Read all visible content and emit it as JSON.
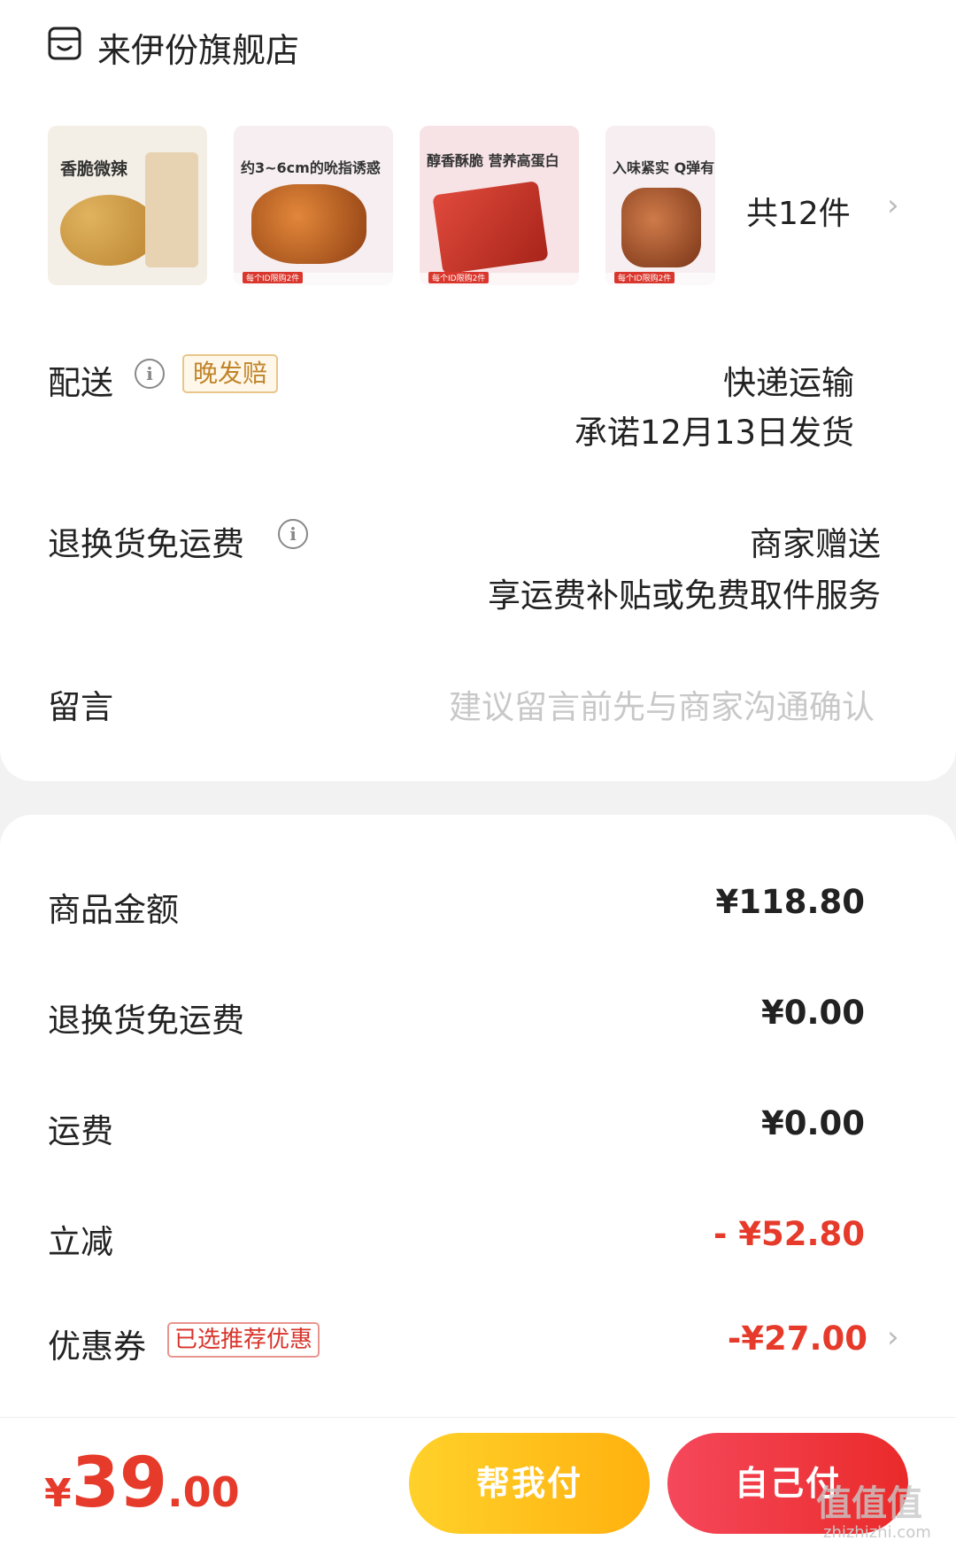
{
  "store": {
    "name": "来伊份旗舰店",
    "icon": "store-icon"
  },
  "products": [
    {
      "headline": "香脆微辣",
      "tag": ""
    },
    {
      "headline": "约3~6cm的吮指诱惑",
      "tag": "每个ID限购2件"
    },
    {
      "headline": "醇香酥脆 营养高蛋白",
      "tag": "每个ID限购2件"
    },
    {
      "headline": "入味紧实 Q弹有",
      "tag": "每个ID限购2件"
    }
  ],
  "product_count": "共12件",
  "delivery": {
    "label": "配送",
    "badge": "晚发赔",
    "method": "快递运输",
    "promise": "承诺12月13日发货"
  },
  "return_freight": {
    "label": "退换货免运费",
    "value1": "商家赠送",
    "value2": "享运费补贴或免费取件服务"
  },
  "message": {
    "label": "留言",
    "placeholder": "建议留言前先与商家沟通确认"
  },
  "summary": {
    "goods_amount_label": "商品金额",
    "goods_amount": "¥118.80",
    "return_freight_label": "退换货免运费",
    "return_freight": "¥0.00",
    "shipping_label": "运费",
    "shipping": "¥0.00",
    "discount_label": "立减",
    "discount": "- ¥52.80",
    "coupon_label": "优惠券",
    "coupon_badge": "已选推荐优惠",
    "coupon": "-¥27.00"
  },
  "footer": {
    "currency": "¥",
    "total_int": "39",
    "total_dec": ".00",
    "help_pay": "帮我付",
    "self_pay": "自己付"
  },
  "watermark": {
    "text": "值值值",
    "url": "zhizhizhi.com"
  },
  "colors": {
    "accent_red": "#e63a2b",
    "help_yellow": "#ffc21b",
    "badge_gold": "#c0842a"
  }
}
